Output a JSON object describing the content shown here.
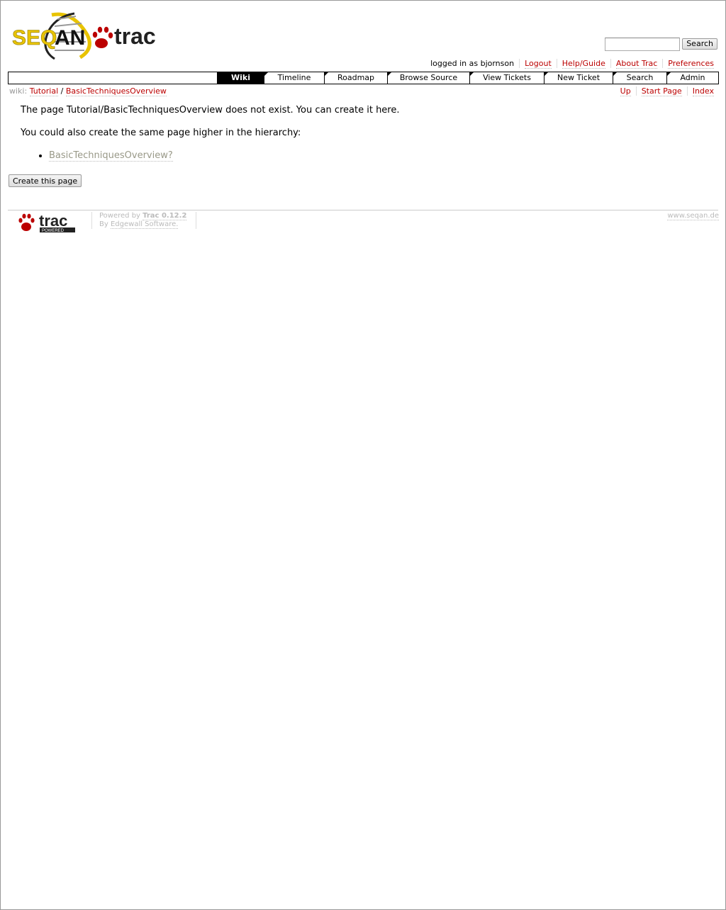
{
  "header": {
    "logo_alt": "SEQAN trac",
    "search_button": "Search",
    "search_value": ""
  },
  "metanav": {
    "logged_in": "logged in as bjornson",
    "items": [
      "Logout",
      "Help/Guide",
      "About Trac",
      "Preferences"
    ]
  },
  "mainnav": {
    "tabs": [
      "Wiki",
      "Timeline",
      "Roadmap",
      "Browse Source",
      "View Tickets",
      "New Ticket",
      "Search",
      "Admin"
    ],
    "active": "Wiki"
  },
  "breadcrumb": {
    "prefix": "wiki:",
    "parent": "Tutorial",
    "separator": "/",
    "current": "BasicTechniquesOverview"
  },
  "ctxnav": {
    "items": [
      "Up",
      "Start Page",
      "Index"
    ]
  },
  "content": {
    "message": "The page Tutorial/BasicTechniquesOverview does not exist. You can create it here.",
    "hierarchy_text": "You could also create the same page higher in the hierarchy:",
    "links": [
      "BasicTechniquesOverview?"
    ]
  },
  "actions": {
    "create_button": "Create this page"
  },
  "footer": {
    "powered_by": "Powered by",
    "trac_version": "Trac 0.12.2",
    "by": "By",
    "company": "Edgewall Software.",
    "site": "www.seqan.de"
  }
}
